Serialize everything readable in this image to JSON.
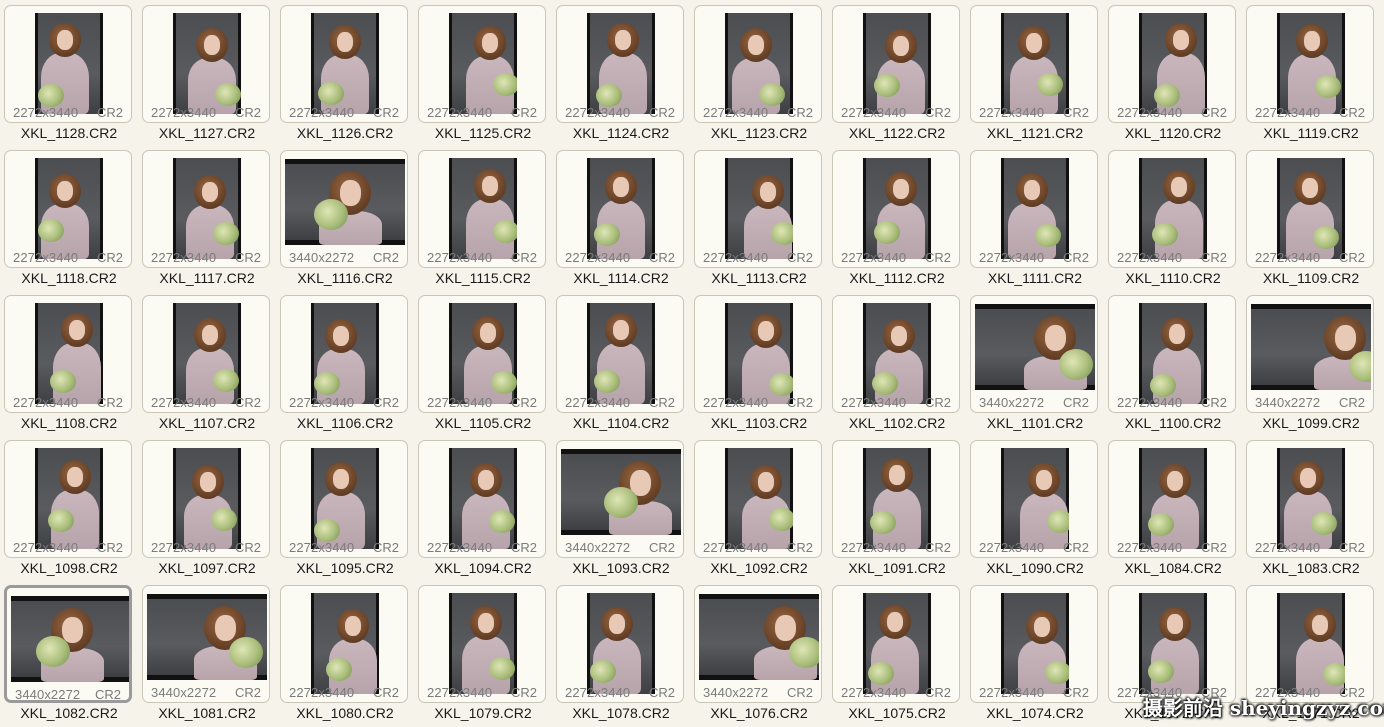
{
  "window": {
    "title": ""
  },
  "grid": {
    "rows": [
      [
        {
          "name": "XKL_1128.CR2",
          "dims": "2272x3440",
          "ext": "CR2"
        },
        {
          "name": "XKL_1127.CR2",
          "dims": "2272x3440",
          "ext": "CR2"
        },
        {
          "name": "XKL_1126.CR2",
          "dims": "2272x3440",
          "ext": "CR2"
        },
        {
          "name": "XKL_1125.CR2",
          "dims": "2272x3440",
          "ext": "CR2"
        },
        {
          "name": "XKL_1124.CR2",
          "dims": "2272x3440",
          "ext": "CR2"
        },
        {
          "name": "XKL_1123.CR2",
          "dims": "2272x3440",
          "ext": "CR2"
        },
        {
          "name": "XKL_1122.CR2",
          "dims": "2272x3440",
          "ext": "CR2"
        },
        {
          "name": "XKL_1121.CR2",
          "dims": "2272x3440",
          "ext": "CR2"
        },
        {
          "name": "XKL_1120.CR2",
          "dims": "2272x3440",
          "ext": "CR2"
        },
        {
          "name": "XKL_1119.CR2",
          "dims": "2272x3440",
          "ext": "CR2"
        }
      ],
      [
        {
          "name": "XKL_1118.CR2",
          "dims": "2272x3440",
          "ext": "CR2"
        },
        {
          "name": "XKL_1117.CR2",
          "dims": "2272x3440",
          "ext": "CR2"
        },
        {
          "name": "XKL_1116.CR2",
          "dims": "3440x2272",
          "ext": "CR2"
        },
        {
          "name": "XKL_1115.CR2",
          "dims": "2272x3440",
          "ext": "CR2"
        },
        {
          "name": "XKL_1114.CR2",
          "dims": "2272x3440",
          "ext": "CR2"
        },
        {
          "name": "XKL_1113.CR2",
          "dims": "2272x3440",
          "ext": "CR2"
        },
        {
          "name": "XKL_1112.CR2",
          "dims": "2272x3440",
          "ext": "CR2"
        },
        {
          "name": "XKL_1111.CR2",
          "dims": "2272x3440",
          "ext": "CR2"
        },
        {
          "name": "XKL_1110.CR2",
          "dims": "2272x3440",
          "ext": "CR2"
        },
        {
          "name": "XKL_1109.CR2",
          "dims": "2272x3440",
          "ext": "CR2"
        }
      ],
      [
        {
          "name": "XKL_1108.CR2",
          "dims": "2272x3440",
          "ext": "CR2"
        },
        {
          "name": "XKL_1107.CR2",
          "dims": "2272x3440",
          "ext": "CR2"
        },
        {
          "name": "XKL_1106.CR2",
          "dims": "2272x3440",
          "ext": "CR2"
        },
        {
          "name": "XKL_1105.CR2",
          "dims": "2272x3440",
          "ext": "CR2"
        },
        {
          "name": "XKL_1104.CR2",
          "dims": "2272x3440",
          "ext": "CR2"
        },
        {
          "name": "XKL_1103.CR2",
          "dims": "2272x3440",
          "ext": "CR2"
        },
        {
          "name": "XKL_1102.CR2",
          "dims": "2272x3440",
          "ext": "CR2"
        },
        {
          "name": "XKL_1101.CR2",
          "dims": "3440x2272",
          "ext": "CR2"
        },
        {
          "name": "XKL_1100.CR2",
          "dims": "2272x3440",
          "ext": "CR2"
        },
        {
          "name": "XKL_1099.CR2",
          "dims": "3440x2272",
          "ext": "CR2"
        }
      ],
      [
        {
          "name": "XKL_1098.CR2",
          "dims": "2272x3440",
          "ext": "CR2"
        },
        {
          "name": "XKL_1097.CR2",
          "dims": "2272x3440",
          "ext": "CR2"
        },
        {
          "name": "XKL_1095.CR2",
          "dims": "2272x3440",
          "ext": "CR2"
        },
        {
          "name": "XKL_1094.CR2",
          "dims": "2272x3440",
          "ext": "CR2"
        },
        {
          "name": "XKL_1093.CR2",
          "dims": "3440x2272",
          "ext": "CR2"
        },
        {
          "name": "XKL_1092.CR2",
          "dims": "2272x3440",
          "ext": "CR2"
        },
        {
          "name": "XKL_1091.CR2",
          "dims": "2272x3440",
          "ext": "CR2"
        },
        {
          "name": "XKL_1090.CR2",
          "dims": "2272x3440",
          "ext": "CR2"
        },
        {
          "name": "XKL_1084.CR2",
          "dims": "2272x3440",
          "ext": "CR2"
        },
        {
          "name": "XKL_1083.CR2",
          "dims": "2272x3440",
          "ext": "CR2"
        }
      ],
      [
        {
          "name": "XKL_1082.CR2",
          "dims": "3440x2272",
          "ext": "CR2",
          "selected": true
        },
        {
          "name": "XKL_1081.CR2",
          "dims": "3440x2272",
          "ext": "CR2"
        },
        {
          "name": "XKL_1080.CR2",
          "dims": "2272x3440",
          "ext": "CR2"
        },
        {
          "name": "XKL_1079.CR2",
          "dims": "2272x3440",
          "ext": "CR2"
        },
        {
          "name": "XKL_1078.CR2",
          "dims": "2272x3440",
          "ext": "CR2"
        },
        {
          "name": "XKL_1076.CR2",
          "dims": "3440x2272",
          "ext": "CR2"
        },
        {
          "name": "XKL_1075.CR2",
          "dims": "2272x3440",
          "ext": "CR2"
        },
        {
          "name": "XKL_1074.CR2",
          "dims": "2272x3440",
          "ext": "CR2"
        },
        {
          "name": "XKL_1072.CR2",
          "dims": "2272x3440",
          "ext": "CR2"
        },
        {
          "name": "XKL_1071.CR2",
          "dims": "2272x3440",
          "ext": "CR2"
        }
      ]
    ]
  },
  "watermark": {
    "text": "摄影前沿 sheyingzyz.com"
  },
  "colors": {
    "background": "#f6f4ea",
    "card_border": "#c9c6b8",
    "selected_border": "#9a9a9a",
    "meta_text": "#7b7b7b"
  }
}
